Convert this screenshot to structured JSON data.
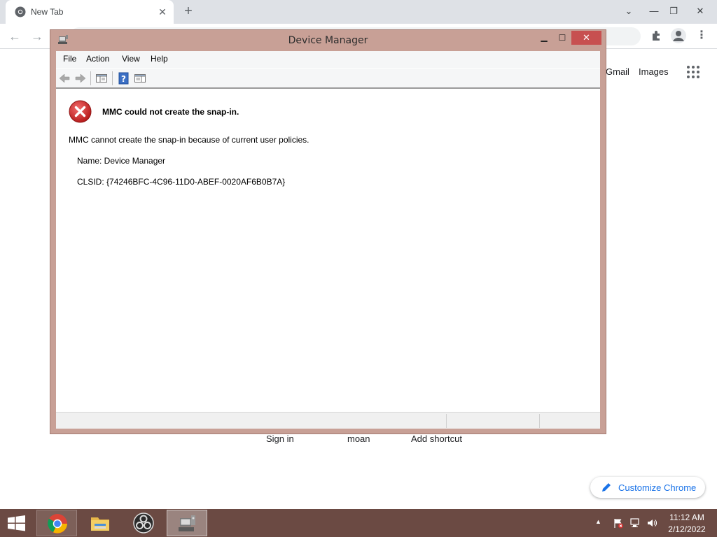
{
  "browser": {
    "tab_title": "New Tab",
    "tab_close": "✕",
    "new_tab": "+",
    "links": {
      "gmail": "Gmail",
      "images": "Images"
    },
    "shortcuts": [
      "Sign in",
      "moan",
      "Add shortcut"
    ],
    "customize_label": "Customize Chrome"
  },
  "mmc": {
    "title": "Device Manager",
    "menu": [
      "File",
      "Action",
      "View",
      "Help"
    ],
    "error_heading": "MMC could not create the snap-in.",
    "error_message": "MMC cannot create the snap-in because of current user policies.",
    "detail_name": "Name: Device Manager",
    "detail_clsid": "CLSID: {74246BFC-4C96-11D0-ABEF-0020AF6B0B7A}"
  },
  "taskbar": {
    "apps": [
      "chrome-icon",
      "file-explorer-icon",
      "obs-icon",
      "device-manager-icon"
    ],
    "clock_time": "11:12 AM",
    "clock_date": "2/12/2022"
  },
  "colors": {
    "window_frame": "#c8a096",
    "taskbar": "#6b4a43",
    "close_button": "#c75050",
    "error_red": "#d32f2f",
    "link_blue": "#1a73e8"
  }
}
